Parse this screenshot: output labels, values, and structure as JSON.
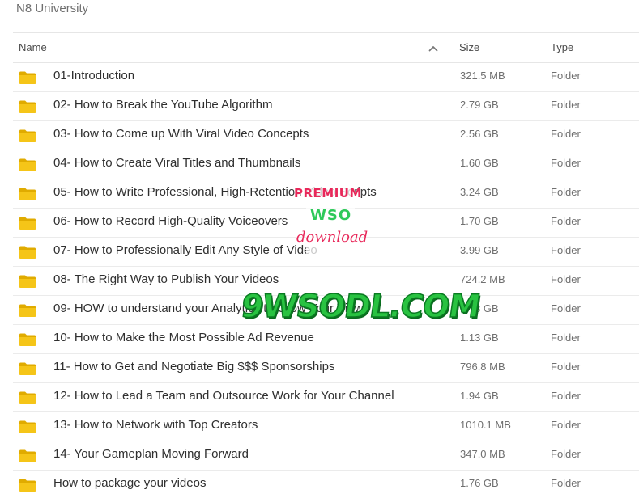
{
  "window": {
    "title": "N8 University"
  },
  "table": {
    "columns": {
      "name": "Name",
      "size": "Size",
      "type": "Type"
    },
    "sort": {
      "column": "name",
      "direction": "ascending",
      "icon": "chevron-up-icon"
    },
    "rows": [
      {
        "name": "01-Introduction",
        "size": "321.5 MB",
        "type": "Folder"
      },
      {
        "name": "02- How to Break the YouTube Algorithm",
        "size": "2.79 GB",
        "type": "Folder"
      },
      {
        "name": "03- How to Come up With Viral Video Concepts",
        "size": "2.56 GB",
        "type": "Folder"
      },
      {
        "name": "04- How to Create Viral Titles and Thumbnails",
        "size": "1.60 GB",
        "type": "Folder"
      },
      {
        "name": "05- How to Write Professional, High-Retention Video Scripts",
        "size": "3.24 GB",
        "type": "Folder"
      },
      {
        "name": "06- How to Record High-Quality Voiceovers",
        "size": "1.70 GB",
        "type": "Folder"
      },
      {
        "name": "07- How to Professionally Edit Any Style of Video",
        "size": "3.99 GB",
        "type": "Folder"
      },
      {
        "name": "08- The Right Way to Publish Your Videos",
        "size": "724.2 MB",
        "type": "Folder"
      },
      {
        "name": "09- HOW to understand your Analytics to Grow Your Views",
        "size": "1.73 GB",
        "type": "Folder"
      },
      {
        "name": "10- How to Make the Most Possible Ad Revenue",
        "size": "1.13 GB",
        "type": "Folder"
      },
      {
        "name": "11- How to Get and Negotiate Big $$$ Sponsorships",
        "size": "796.8 MB",
        "type": "Folder"
      },
      {
        "name": "12- How to Lead a Team and Outsource Work for Your Channel",
        "size": "1.94 GB",
        "type": "Folder"
      },
      {
        "name": "13- How to Network with Top Creators",
        "size": "1010.1 MB",
        "type": "Folder"
      },
      {
        "name": "14- Your Gameplan Moving Forward",
        "size": "347.0 MB",
        "type": "Folder"
      },
      {
        "name": "How to package your videos",
        "size": "1.76 GB",
        "type": "Folder"
      }
    ],
    "row_icon": "folder-icon"
  },
  "watermark": {
    "line1": "PREMIUM",
    "line2": "WSO",
    "line3": "download",
    "domain": "9WSODL.COM"
  },
  "colors": {
    "folder": "#f5c518",
    "folder_dark": "#e0ab00",
    "watermark_pink": "#e8285a",
    "watermark_green": "#29c241"
  }
}
